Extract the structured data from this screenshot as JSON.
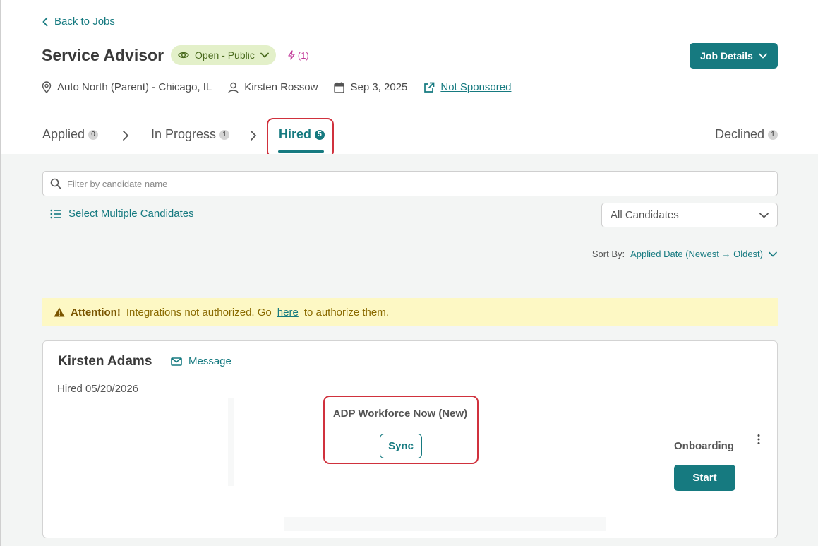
{
  "header": {
    "back_label": "Back to Jobs",
    "job_title": "Service Advisor",
    "status": "Open - Public",
    "boost_count": "(1)",
    "job_details_label": "Job Details",
    "location": "Auto North (Parent) - Chicago, IL",
    "recruiter": "Kirsten Rossow",
    "date": "Sep 3, 2025",
    "sponsorship": "Not Sponsored"
  },
  "tabs": [
    {
      "label": "Applied",
      "count": "0"
    },
    {
      "label": "In Progress",
      "count": "1"
    },
    {
      "label": "Hired",
      "count": "5"
    },
    {
      "label": "Declined",
      "count": "1"
    }
  ],
  "filters": {
    "search_placeholder": "Filter by candidate name",
    "select_multiple_label": "Select Multiple Candidates",
    "candidate_filter_value": "All Candidates",
    "sort_label": "Sort By:",
    "sort_value": "Applied Date (Newest → Oldest)"
  },
  "alert": {
    "title": "Attention!",
    "text_before": "Integrations not authorized. Go",
    "link": "here",
    "text_after": "to authorize them."
  },
  "candidate": {
    "name": "Kirsten Adams",
    "message_label": "Message",
    "hired_date": "Hired 05/20/2026",
    "integration_name": "ADP Workforce Now (New)",
    "sync_label": "Sync",
    "onboarding_label": "Onboarding",
    "start_label": "Start"
  },
  "colors": {
    "accent": "#167a80",
    "highlight": "#d0313d",
    "alert_bg": "#fdf8c4",
    "status_bg": "#e3f0c9"
  }
}
